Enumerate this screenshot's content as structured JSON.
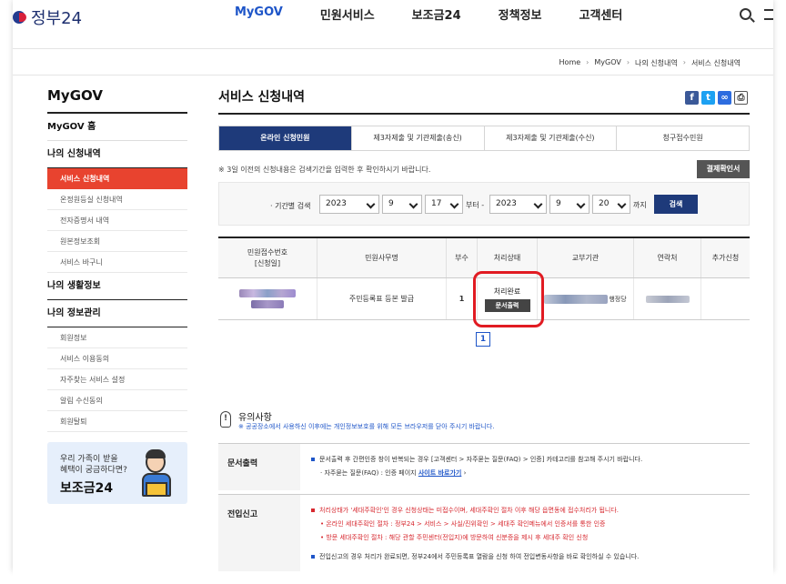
{
  "header": {
    "logo_text": "정부24",
    "nav": [
      "MyGOV",
      "민원서비스",
      "보조금24",
      "정책정보",
      "고객센터"
    ]
  },
  "breadcrumb": [
    "Home",
    "MyGOV",
    "나의 신청내역",
    "서비스 신청내역"
  ],
  "sidebar": {
    "title": "MyGOV",
    "home": "MyGOV 홈",
    "group1": "나의 신청내역",
    "group1_items": [
      "서비스 신청내역",
      "온정원등실 신청내역",
      "전자증명서 내역",
      "원본정보조회",
      "서비스 바구니"
    ],
    "group2": "나의 생활정보",
    "group3": "나의 정보관리",
    "group3_items": [
      "회원정보",
      "서비스 이용동의",
      "자주찾는 서비스 설정",
      "알림 수신동의",
      "회원탈퇴"
    ],
    "promo": {
      "line1": "우리 가족이 받을",
      "line2": "혜택이 궁금하다면?",
      "big": "보조금24"
    }
  },
  "main": {
    "title": "서비스 신청내역",
    "share_icons": [
      "f",
      "t",
      "∞",
      "⎙"
    ],
    "tabs": [
      "온라인 신청민원",
      "제3자제출 및 기관제출(송신)",
      "제3자제출 및 기관제출(수신)",
      "청구접수민원"
    ],
    "notice": "※ 3일 이전의 신청내용은 검색기간을 입력한 후 확인하시기 바랍니다.",
    "confirm_button": "결제확인서",
    "period": {
      "label": "· 기간별 검색",
      "from_year": "2023",
      "from_month": "9",
      "from_day": "17",
      "from_suffix": "부터 -",
      "to_year": "2023",
      "to_month": "9",
      "to_day": "20",
      "to_suffix": "까지",
      "search_button": "검색"
    },
    "table": {
      "headers": [
        "민원접수번호\n[신청일]",
        "민원사무명",
        "부수",
        "처리상태",
        "교부기관",
        "연락처",
        "추가신청"
      ],
      "rows": [
        {
          "name": "주민등록표 등본 발급",
          "count": "1",
          "status": "처리완료",
          "doc_button": "문서출력",
          "agency_suffix": "행정당"
        }
      ]
    },
    "page": "1",
    "caution": {
      "title": "유의사항",
      "sub": "※ 공공장소에서 사용하신 이후에는 개인정보보호를 위해 모든 브라우저를 닫아 주시기 바랍니다."
    },
    "doc_print": {
      "head": "문서출력",
      "line1": "문서출력 후 간편인증 창이 반복되는 경우 [고객센터 > 자주묻는 질문(FAQ) > 인증] 카테고리를 참고해 주시기 바랍니다.",
      "line2": "자주묻는 질문(FAQ) : 인증 페이지",
      "link": "사이트 바로가기"
    },
    "move_in": {
      "head": "전입신고",
      "line1": "처리상태가 '세대주확인'인 경우 신청상태는 미접수이며, 세대주확인 절차 이후 해당 읍면동에 접수처리가 됩니다.",
      "line2": "온라인 세대주확인 절차 : 정부24 > 서비스 > 사실/진위확인 > 세대주 확인메뉴에서 인증서를 통한 인증",
      "line3": "방문 세대주확인 절차 : 해당 관할 주민센터(전입지)에 방문하여 신분증을 제시 후 세대주 확인 신청",
      "line4": "전입신고의 경우 처리가 완료되면, 정부24에서 주민등록표 열람을 신청 하여 전입변동사항을 바로 확인하실 수 있습니다."
    }
  }
}
